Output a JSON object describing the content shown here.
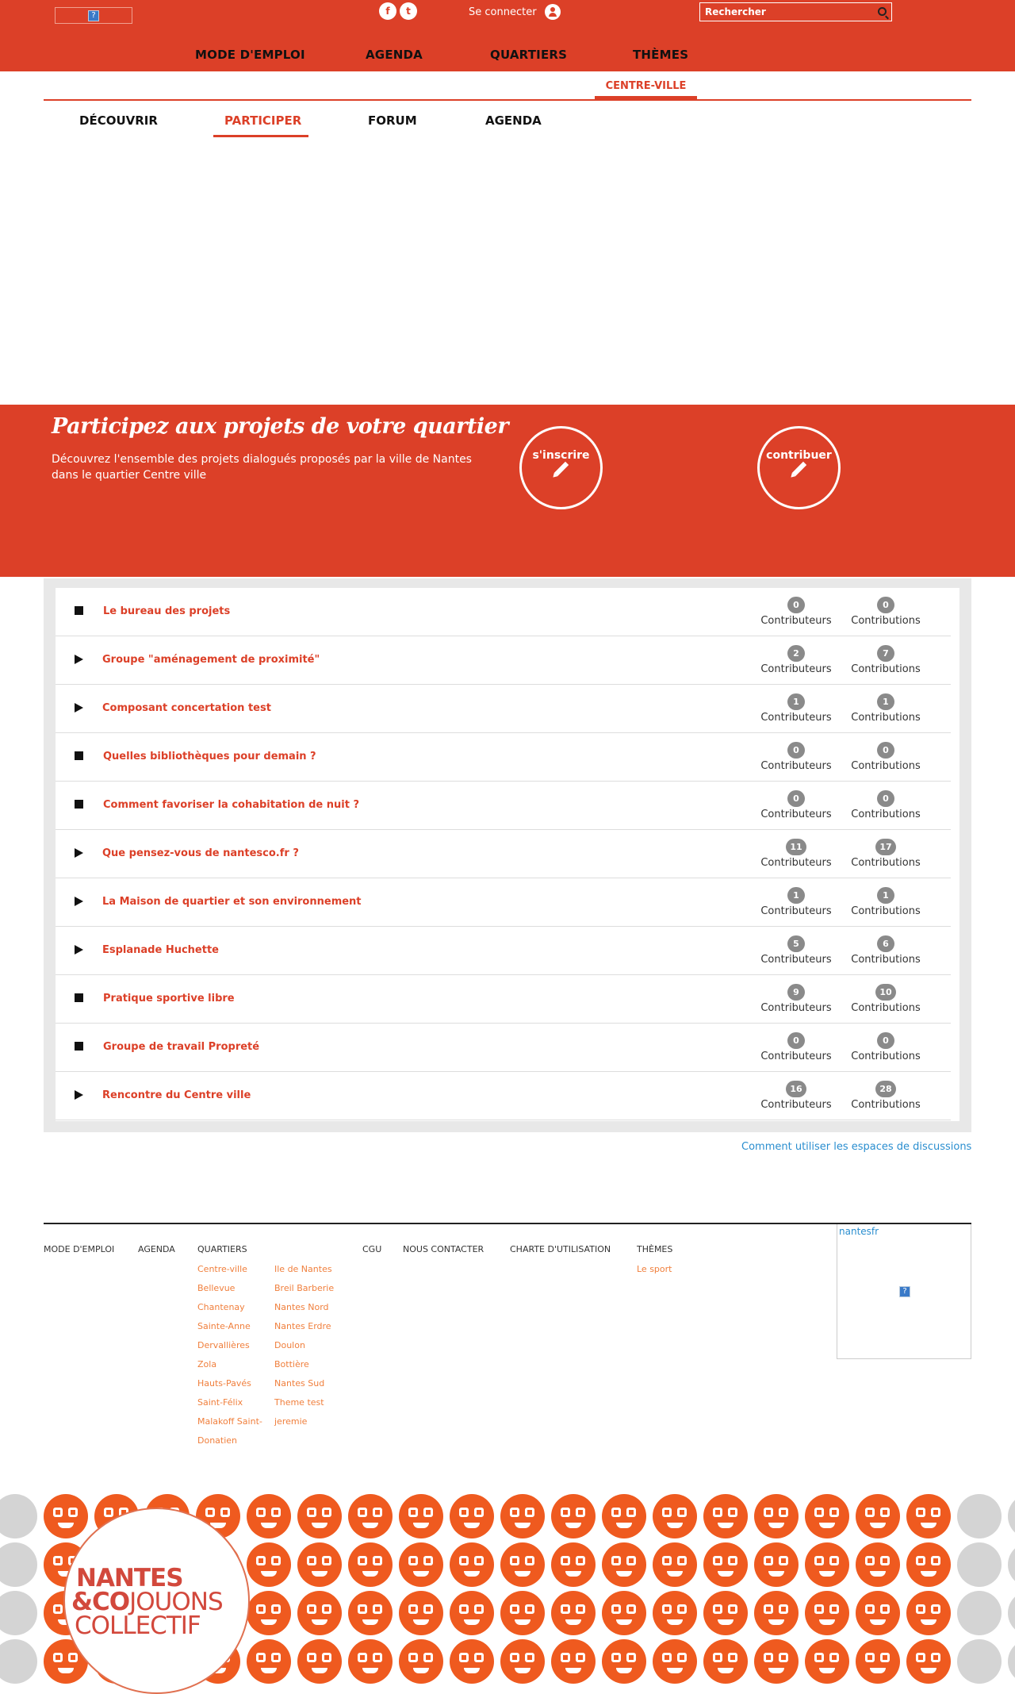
{
  "header": {
    "login_label": "Se connecter",
    "search_placeholder": "Rechercher",
    "nav": [
      "MODE D'EMPLOI",
      "AGENDA",
      "QUARTIERS",
      "THÈMES"
    ],
    "social": [
      "f",
      "t"
    ]
  },
  "quartier": {
    "name": "CENTRE-VILLE"
  },
  "tabs": [
    "DÉCOUVRIR",
    "PARTICIPER",
    "FORUM",
    "AGENDA"
  ],
  "banner": {
    "title": "Participez aux projets de votre quartier",
    "description": "Découvrez l'ensemble des projets dialogués proposés par la ville de Nantes dans le quartier Centre ville",
    "signup_label": "s'inscrire",
    "contribute_label": "contribuer"
  },
  "projects": [
    {
      "title": "Le bureau des projets",
      "status": "closed",
      "contributeurs": "0",
      "contributions": "0"
    },
    {
      "title": "Groupe \"aménagement de proximité\"",
      "status": "open",
      "contributeurs": "2",
      "contributions": "7"
    },
    {
      "title": "Composant concertation test",
      "status": "open",
      "contributeurs": "1",
      "contributions": "1"
    },
    {
      "title": "Quelles bibliothèques pour demain ?",
      "status": "closed",
      "contributeurs": "0",
      "contributions": "0"
    },
    {
      "title": "Comment favoriser la cohabitation de nuit ?",
      "status": "closed",
      "contributeurs": "0",
      "contributions": "0"
    },
    {
      "title": "Que pensez-vous de nantesco.fr ?",
      "status": "open",
      "contributeurs": "11",
      "contributions": "17"
    },
    {
      "title": "La Maison de quartier et son environnement",
      "status": "open",
      "contributeurs": "1",
      "contributions": "1"
    },
    {
      "title": "Esplanade Huchette",
      "status": "open",
      "contributeurs": "5",
      "contributions": "6"
    },
    {
      "title": "Pratique sportive libre",
      "status": "closed",
      "contributeurs": "9",
      "contributions": "10"
    },
    {
      "title": "Groupe de travail Propreté",
      "status": "closed",
      "contributeurs": "0",
      "contributions": "0"
    },
    {
      "title": "Rencontre du Centre ville",
      "status": "open",
      "contributeurs": "16",
      "contributions": "28"
    }
  ],
  "labels": {
    "contributeurs": "Contributeurs",
    "contributions": "Contributions"
  },
  "help_link": "Comment utiliser les espaces de discussions",
  "footer": {
    "mode_emploi": "MODE D'EMPLOI",
    "agenda": "AGENDA",
    "quartiers": "QUARTIERS",
    "cgu": "CGU",
    "contact": "NOUS CONTACTER",
    "charte": "CHARTE D'UTILISATION",
    "themes": "THÈMES",
    "quartiers_col1": [
      "Centre-ville",
      "Bellevue",
      "Chantenay",
      "Sainte-Anne",
      "Dervallières",
      "Zola",
      "Hauts-Pavés",
      "Saint-Félix",
      "Malakoff Saint-",
      "Donatien"
    ],
    "quartiers_col2": [
      "Ile de Nantes",
      "Breil Barberie",
      "Nantes Nord",
      "Nantes Erdre",
      "Doulon",
      "Bottière",
      "Nantes Sud",
      "Theme test",
      "jeremie"
    ],
    "themes_list": [
      "Le sport"
    ],
    "widget_title": "nantesfr"
  },
  "brand": {
    "line1": "NANTES",
    "line2a": "&CO",
    "line2b": "JOUONS",
    "line3": "COLLECTIF"
  },
  "colors": {
    "brand_red": "#dc4028",
    "link_orange": "#f07f3c",
    "link_blue": "#2a8ecf",
    "badge_grey": "#8a8a8a"
  }
}
